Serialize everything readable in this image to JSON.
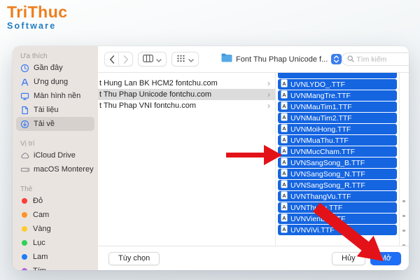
{
  "logo": {
    "title": "TriThuc",
    "subtitle": "Software"
  },
  "colors": {
    "accent_blue": "#3b7df0",
    "selection_blue": "#1565e1",
    "primary_button_blue": "#1f6ef6",
    "arrow_red": "#e31219",
    "logo_orange": "#ee7e1d",
    "logo_blue": "#1d7cc5",
    "gray_icon": "#8e8e93",
    "folder_icon_blue": "#55aae6"
  },
  "dialog": {
    "toolbar": {
      "back_icon": "chevron-left-icon",
      "forward_icon": "chevron-right-icon",
      "column_view_icon": "columns-icon",
      "group_view_icon": "grid-dots-icon",
      "folder_icon": "folder-icon",
      "folder_label": "Font Thu Phap Unicode f...",
      "stepper_icon": "up-down-stepper-icon",
      "search_icon": "search-icon",
      "search_placeholder": "Tìm kiếm"
    },
    "sidebar": {
      "sections": [
        {
          "header": "Ưa thích",
          "items": [
            {
              "id": "recents",
              "label": "Gần đây",
              "icon": "clock-icon",
              "selected": false
            },
            {
              "id": "applications",
              "label": "Ứng dụng",
              "icon": "app-icon",
              "selected": false
            },
            {
              "id": "desktop",
              "label": "Màn hình nền",
              "icon": "desktop-icon",
              "selected": false
            },
            {
              "id": "documents",
              "label": "Tài liệu",
              "icon": "document-icon",
              "selected": false
            },
            {
              "id": "downloads",
              "label": "Tải về",
              "icon": "download-icon",
              "selected": true
            }
          ]
        },
        {
          "header": "Vị trí",
          "items": [
            {
              "id": "icloud-drive",
              "label": "iCloud Drive",
              "icon": "cloud-icon",
              "selected": false
            },
            {
              "id": "macos-monterey",
              "label": "macOS Monterey",
              "icon": "drive-icon",
              "selected": false
            }
          ]
        },
        {
          "header": "Thẻ",
          "items": [
            {
              "id": "tag-red",
              "label": "Đỏ",
              "color": "#fc3d39"
            },
            {
              "id": "tag-orange",
              "label": "Cam",
              "color": "#fd9426"
            },
            {
              "id": "tag-yellow",
              "label": "Vàng",
              "color": "#fecb2e"
            },
            {
              "id": "tag-green",
              "label": "Lục",
              "color": "#2fd158"
            },
            {
              "id": "tag-blue",
              "label": "Lam",
              "color": "#1c7cf6"
            },
            {
              "id": "tag-purple",
              "label": "Tím",
              "color": "#b25fe3"
            }
          ]
        }
      ]
    },
    "browser": {
      "folders": [
        {
          "label": "t Hung Lan BK HCM2 fontchu.com",
          "selected": false
        },
        {
          "label": "t Thu Phap Unicode fontchu.com",
          "selected": true
        },
        {
          "label": "t Thu Phap VNI fontchu.com",
          "selected": false
        }
      ],
      "file_icon": "font-file-icon",
      "files": [
        "UVNLYDO_.TTF",
        "UVNMangTre.TTF",
        "UVNMauTim1.TTF",
        "UVNMauTim2.TTF",
        "UVNMoiHong.TTF",
        "UVNMuaThu.TTF",
        "UVNMucCham.TTF",
        "UVNSangSong_B.TTF",
        "UVNSangSong_N.TTF",
        "UVNSangSong_R.TTF",
        "UVNThangVu.TTF",
        "UVNThuTu.TTF",
        "UVNVienDu.TTF",
        "UVNViVi.TTF"
      ]
    },
    "footer": {
      "options_label": "Tùy chọn",
      "cancel_label": "Hủy",
      "open_label": "Mở"
    }
  }
}
